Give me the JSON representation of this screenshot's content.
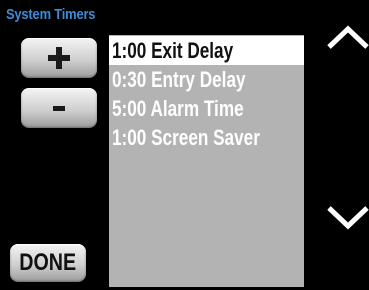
{
  "screen": {
    "title": "System Timers"
  },
  "buttons": {
    "increase": {
      "icon": "plus-icon"
    },
    "decrease": {
      "icon": "minus-icon"
    },
    "done_label": "DONE"
  },
  "timers": {
    "items": [
      {
        "label": "1:00 Exit Delay",
        "selected": true
      },
      {
        "label": "0:30 Entry Delay",
        "selected": false
      },
      {
        "label": "5:00 Alarm Time",
        "selected": false
      },
      {
        "label": "1:00 Screen Saver",
        "selected": false
      }
    ]
  },
  "scroll": {
    "up_icon": "chevron-up-icon",
    "down_icon": "chevron-down-icon"
  },
  "colors": {
    "title": "#3d8bd6",
    "list_background": "#b3b3b3",
    "selection": "#ffffff",
    "background": "#000000"
  }
}
